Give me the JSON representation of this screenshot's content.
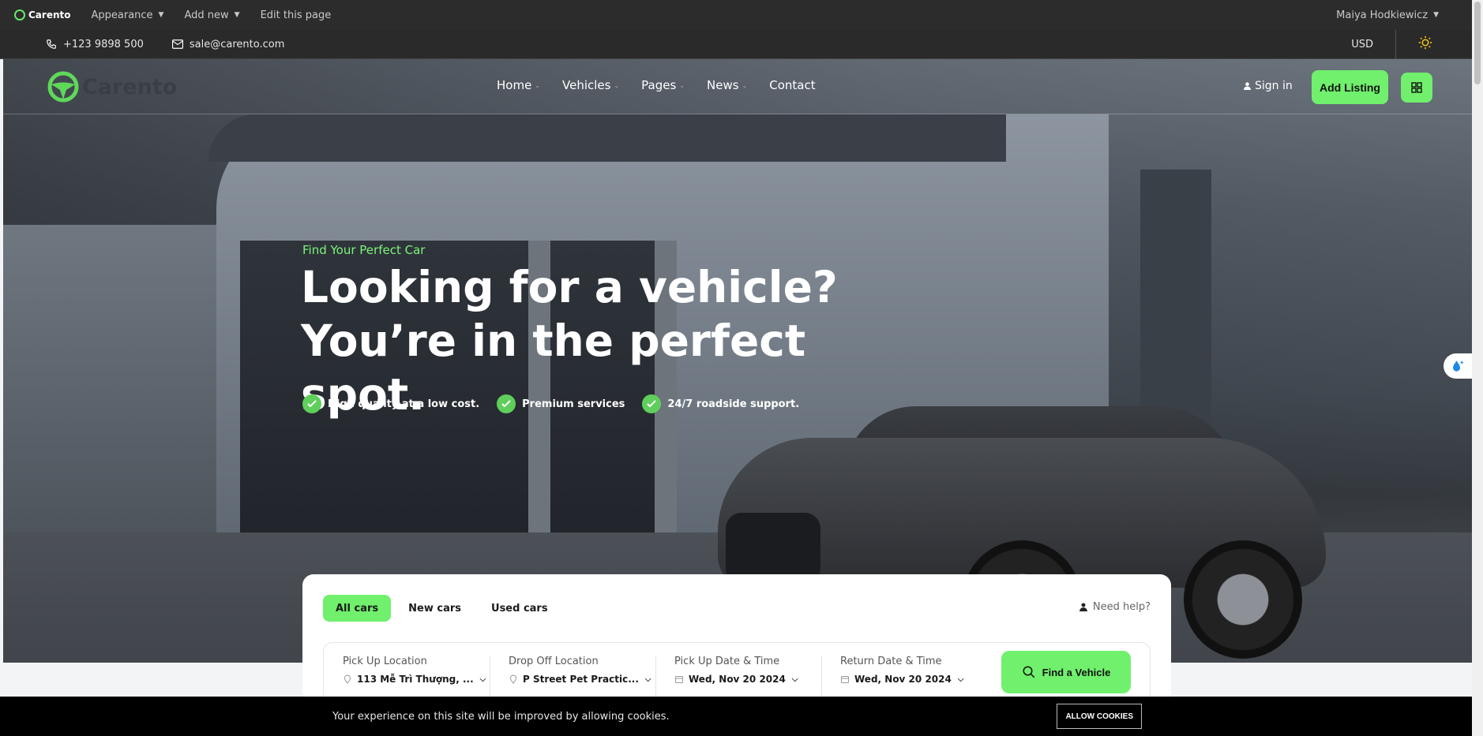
{
  "adminbar": {
    "site": "Carento",
    "items": [
      "Appearance",
      "Add new",
      "Edit this page"
    ],
    "user": "Maiya Hodkiewicz"
  },
  "infobar": {
    "phone": "+123 9898 500",
    "email": "sale@carento.com",
    "currency": "USD"
  },
  "header": {
    "logo": "Carento",
    "nav": [
      "Home",
      "Vehicles",
      "Pages",
      "News",
      "Contact"
    ],
    "signin": "Sign in",
    "add_listing": "Add Listing"
  },
  "hero": {
    "eyebrow": "Find Your Perfect Car",
    "headline_1": "Looking for a vehicle?",
    "headline_2": "You’re in the perfect spot.",
    "features": [
      "High quality at a low cost.",
      "Premium services",
      "24/7 roadside support."
    ]
  },
  "search": {
    "tabs": [
      "All cars",
      "New cars",
      "Used cars"
    ],
    "need_help": "Need help?",
    "fields": [
      {
        "label": "Pick Up Location",
        "value": "113 Mễ Trì Thượng, ..."
      },
      {
        "label": "Drop Off Location",
        "value": "P Street Pet Practic..."
      },
      {
        "label": "Pick Up Date & Time",
        "value": "Wed, Nov 20 2024"
      },
      {
        "label": "Return Date & Time",
        "value": "Wed, Nov 20 2024"
      }
    ],
    "button": "Find a Vehicle"
  },
  "cookie": {
    "message": "Your experience on this site will be improved by allowing cookies.",
    "button": "ALLOW COOKIES"
  },
  "colors": {
    "accent": "#70f06c",
    "dark": "#2c2c2c"
  }
}
